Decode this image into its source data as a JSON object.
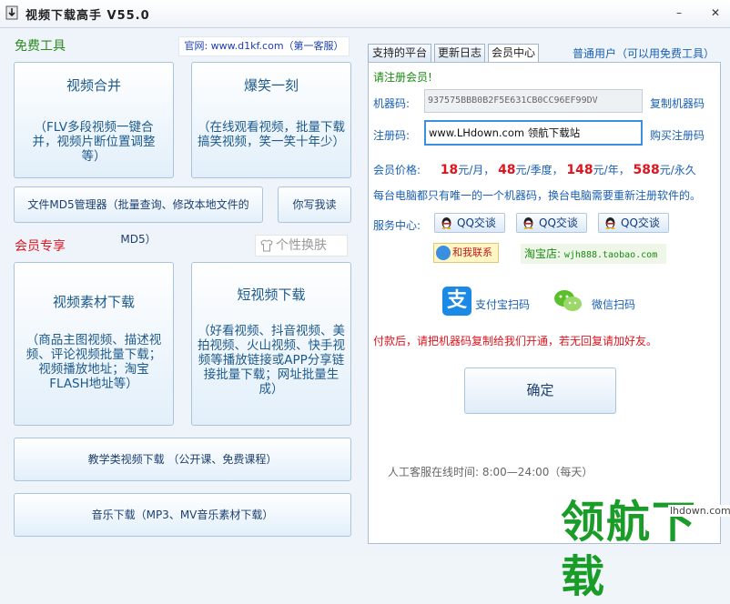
{
  "window": {
    "title": "视频下载高手 V55.0",
    "minimize": "–",
    "close": "✕"
  },
  "left": {
    "free_title": "免费工具",
    "website": "官网: www.d1kf.com（第一客服）",
    "tiles": {
      "merge": {
        "title": "视频合并",
        "desc": "（FLV多段视频一键合并，视频片断位置调整等）"
      },
      "funny": {
        "title": "爆笑一刻",
        "desc": "（在线观看视频，批量下载搞笑视频，笑一笑十年少）"
      },
      "md5": {
        "label": "文件MD5管理器（批量查询、修改本地文件的MD5）"
      },
      "write": {
        "label": "你写我读"
      }
    },
    "vip_title": "会员专享",
    "skin": "个性换肤",
    "vip_tiles": {
      "material": {
        "title": "视频素材下载",
        "desc": "（商品主图视频、描述视频、评论视频批量下载；视频播放地址；淘宝FLASH地址等）"
      },
      "short": {
        "title": "短视频下载",
        "desc": "（好看视频、抖音视频、美拍视频、火山视频、快手视频等播放链接或APP分享链接批量下载；网址批量生成）"
      },
      "edu": {
        "label": "教学类视频下载 （公开课、免费课程）"
      },
      "music": {
        "label": "音乐下载（MP3、MV音乐素材下载）"
      }
    }
  },
  "right": {
    "tabs": [
      "支持的平台",
      "更新日志",
      "会员中心"
    ],
    "active_tab": "会员中心",
    "user_status": "普通用户（可以用免费工具）",
    "please_register": "请注册会员!",
    "machine_label": "机器码:",
    "machine_code": "937575BBB0B2F5E631CB0CC96EF99DV",
    "copy_machine": "复制机器码",
    "reg_label": "注册码:",
    "reg_value": "www.LHdown.com   领航下载站",
    "buy_code": "购买注册码",
    "price_label": "会员价格:",
    "prices": [
      {
        "num": "18",
        "unit": "元/月"
      },
      {
        "num": "48",
        "unit": "元/季度"
      },
      {
        "num": "148",
        "unit": "元/年"
      },
      {
        "num": "588",
        "unit": "元/永久"
      }
    ],
    "note_machine": "每台电脑都只有唯一的一个机器码，换台电脑需要重新注册软件的。",
    "service_label": "服务中心:",
    "qq_label": "QQ交谈",
    "contact_label": "和我联系",
    "taobao_label": "淘宝店: ",
    "taobao_url": "wjh888.taobao.com",
    "alipay_label": "支付宝扫码",
    "wechat_label": "微信扫码",
    "pay_note": "付款后，请把机器码复制给我们开通，若无回复请加好友。",
    "confirm": "确定",
    "service_hours": "人工客服在线时间: 8:00—24:00（每天）"
  },
  "watermark": {
    "text": "领航下载",
    "url": "lhdown.com"
  },
  "colors": {
    "free": "#2a8a1e",
    "vip": "#e0141e",
    "link": "#1a5fb4",
    "price": "#e0141e",
    "accent": "#3b8fe0"
  }
}
